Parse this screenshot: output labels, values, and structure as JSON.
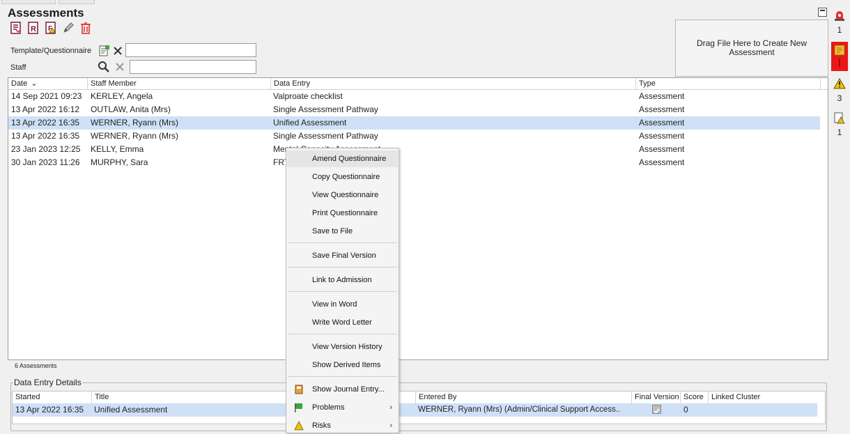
{
  "panel": {
    "title": "Assessments"
  },
  "toolbar": {
    "icons": [
      "assessment-report-icon",
      "report-r-icon",
      "report-flag-icon",
      "edit-pencil-icon",
      "delete-bin-icon"
    ]
  },
  "filters": {
    "template_label": "Template/Questionnaire",
    "template_value": "",
    "staff_label": "Staff",
    "staff_value": ""
  },
  "dropzone": {
    "text": "Drag File Here to Create New Assessment"
  },
  "grid": {
    "columns": [
      "Date",
      "Staff Member",
      "Data Entry",
      "Type"
    ],
    "sort_indicator": "⌄",
    "rows": [
      {
        "date": "14 Sep 2021 09:23",
        "staff": "KERLEY, Angela",
        "entry": "Valproate checklist",
        "type": "Assessment"
      },
      {
        "date": "13 Apr 2022 16:12",
        "staff": "OUTLAW, Anita (Mrs)",
        "entry": "Single Assessment Pathway",
        "type": "Assessment"
      },
      {
        "date": "13 Apr 2022 16:35",
        "staff": "WERNER, Ryann (Mrs)",
        "entry": "Unified Assessment",
        "type": "Assessment"
      },
      {
        "date": "13 Apr 2022 16:35",
        "staff": "WERNER, Ryann (Mrs)",
        "entry": "Single Assessment Pathway",
        "type": "Assessment"
      },
      {
        "date": "23 Jan 2023 12:25",
        "staff": "KELLY, Emma",
        "entry": "Mental Capacity Assessment",
        "type": "Assessment"
      },
      {
        "date": "30 Jan 2023 11:26",
        "staff": "MURPHY, Sara",
        "entry": "FRT",
        "type": "Assessment"
      }
    ],
    "selected_row": 2,
    "count_text": "6 Assessments"
  },
  "details": {
    "legend": "Data Entry Details",
    "columns": [
      "Started",
      "Title",
      "Entered By",
      "Final Version",
      "Score",
      "Linked Cluster"
    ],
    "row": {
      "started": "13 Apr 2022 16:35",
      "title": "Unified Assessment",
      "entered_by": "WERNER, Ryann (Mrs) (Admin/Clinical Support Access..",
      "final_version_checked": true,
      "score": "0",
      "linked_cluster": ""
    }
  },
  "context_menu": {
    "items": [
      {
        "label": "Amend Questionnaire"
      },
      {
        "label": "Copy Questionnaire"
      },
      {
        "label": "View Questionnaire"
      },
      {
        "label": "Print Questionnaire"
      },
      {
        "label": "Save to File"
      },
      {
        "label": "Save Final Version"
      },
      {
        "label": "Link to Admission"
      },
      {
        "label": "View in Word"
      },
      {
        "label": "Write Word Letter"
      },
      {
        "label": "View Version History"
      },
      {
        "label": "Show Derived Items"
      },
      {
        "label": "Show Journal Entry..."
      },
      {
        "label": "Problems"
      },
      {
        "label": "Risks"
      }
    ],
    "highlighted_index": 0
  },
  "sidebar": {
    "alerts": [
      {
        "icon": "alarm-icon",
        "count": "1"
      },
      {
        "icon": "note-alert-icon",
        "count": ""
      },
      {
        "icon": "warning-icon",
        "count": "3"
      },
      {
        "icon": "document-warning-icon",
        "count": "1"
      }
    ]
  },
  "colors": {
    "selection": "#cfe0f7",
    "menu_highlight": "#e5e5e5",
    "alert_red": "#e81818",
    "delete_red": "#e03030"
  }
}
